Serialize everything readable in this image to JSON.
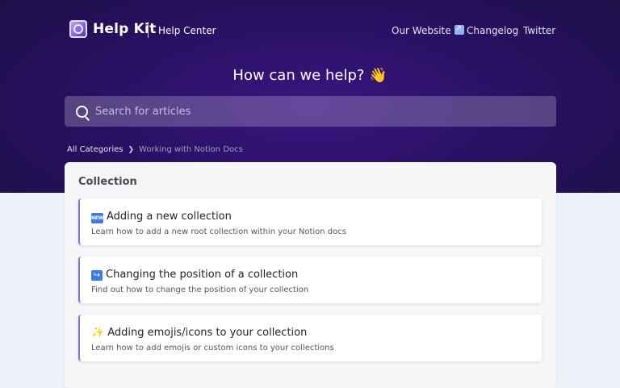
{
  "header": {
    "brand_name": "Help Kit",
    "brand_sub": "Help Center",
    "nav": [
      {
        "label": "Our Website"
      },
      {
        "label": "Changelog"
      },
      {
        "label": "Twitter"
      }
    ]
  },
  "hero": {
    "title": "How can we help? 👋"
  },
  "search": {
    "placeholder": "Search for articles"
  },
  "breadcrumb": {
    "root": "All Categories",
    "current": "Working with Notion Docs"
  },
  "collection": {
    "title": "Collection",
    "articles": [
      {
        "badge": "NEW",
        "title": "Adding a new collection",
        "desc": "Learn how to add a new root collection within your Notion docs"
      },
      {
        "badge": "↪",
        "title": "Changing the position of a collection",
        "desc": "Find out how to change the position of your collection"
      },
      {
        "badge": "✨",
        "title": "Adding emojis/icons to your collection",
        "desc": "Learn how to add emojis or custom icons to your collections"
      }
    ]
  },
  "colors": {
    "hero_dark": "#1b0f45",
    "hero_mid": "#3a1580",
    "accent": "#8b6bd9",
    "page_bg": "#eef1f7",
    "badge_blue": "#3b7be0"
  }
}
